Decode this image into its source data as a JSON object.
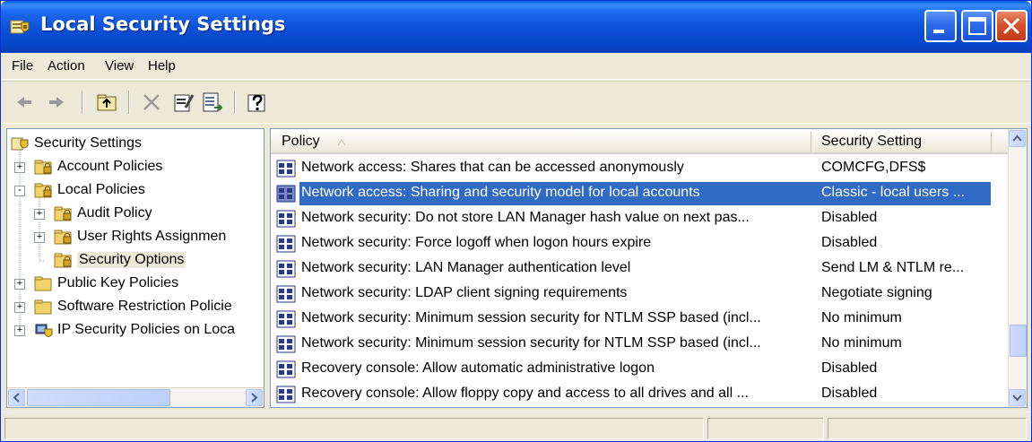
{
  "window": {
    "title": "Local Security Settings",
    "icon": "security-settings-icon",
    "controls": [
      "minimize",
      "maximize",
      "close"
    ]
  },
  "menu": {
    "items": [
      {
        "label": "File"
      },
      {
        "label": "Action"
      },
      {
        "label": "View"
      },
      {
        "label": "Help"
      }
    ]
  },
  "toolbar": {
    "buttons": [
      "back-icon",
      "forward-icon",
      "up-folder-icon",
      "delete-icon",
      "properties-icon",
      "export-list-icon",
      "help-icon"
    ]
  },
  "tree": {
    "items": [
      {
        "label": "Security Settings",
        "icon": "security-settings-icon",
        "expander": ""
      },
      {
        "label": "Account Policies",
        "icon": "folder-lock-icon",
        "expander": "+"
      },
      {
        "label": "Local Policies",
        "icon": "folder-lock-icon",
        "expander": "-"
      },
      {
        "label": "Audit Policy",
        "icon": "folder-lock-icon",
        "expander": "+"
      },
      {
        "label": "User Rights Assignmen",
        "icon": "folder-lock-icon",
        "expander": "+"
      },
      {
        "label": "Security Options",
        "icon": "folder-lock-icon",
        "expander": ""
      },
      {
        "label": "Public Key Policies",
        "icon": "folder-icon",
        "expander": "+"
      },
      {
        "label": "Software Restriction Policie",
        "icon": "folder-icon",
        "expander": "+"
      },
      {
        "label": "IP Security Policies on Loca",
        "icon": "ip-security-icon",
        "expander": "+"
      }
    ],
    "selected": "Security Options"
  },
  "list": {
    "columns": [
      {
        "label": "Policy",
        "sort": "ascending"
      },
      {
        "label": "Security Setting"
      }
    ],
    "rows": [
      {
        "policy": "Network access: Shares that can be accessed anonymously",
        "setting": "COMCFG,DFS$",
        "selected": false
      },
      {
        "policy": "Network access: Sharing and security model for local accounts",
        "setting": "Classic - local users ...",
        "selected": true
      },
      {
        "policy": "Network security: Do not store LAN Manager hash value on next pas...",
        "setting": "Disabled",
        "selected": false
      },
      {
        "policy": "Network security: Force logoff when logon hours expire",
        "setting": "Disabled",
        "selected": false
      },
      {
        "policy": "Network security: LAN Manager authentication level",
        "setting": "Send LM & NTLM re...",
        "selected": false
      },
      {
        "policy": "Network security: LDAP client signing requirements",
        "setting": "Negotiate signing",
        "selected": false
      },
      {
        "policy": "Network security: Minimum session security for NTLM SSP based (incl...",
        "setting": "No minimum",
        "selected": false
      },
      {
        "policy": "Network security: Minimum session security for NTLM SSP based (incl...",
        "setting": "No minimum",
        "selected": false
      },
      {
        "policy": "Recovery console: Allow automatic administrative logon",
        "setting": "Disabled",
        "selected": false
      },
      {
        "policy": "Recovery console: Allow floppy copy and access to all drives and all ...",
        "setting": "Disabled",
        "selected": false
      }
    ]
  },
  "colors": {
    "titlebar": "#0A50D6",
    "selection": "#316AC5",
    "face": "#ECE9D8"
  }
}
